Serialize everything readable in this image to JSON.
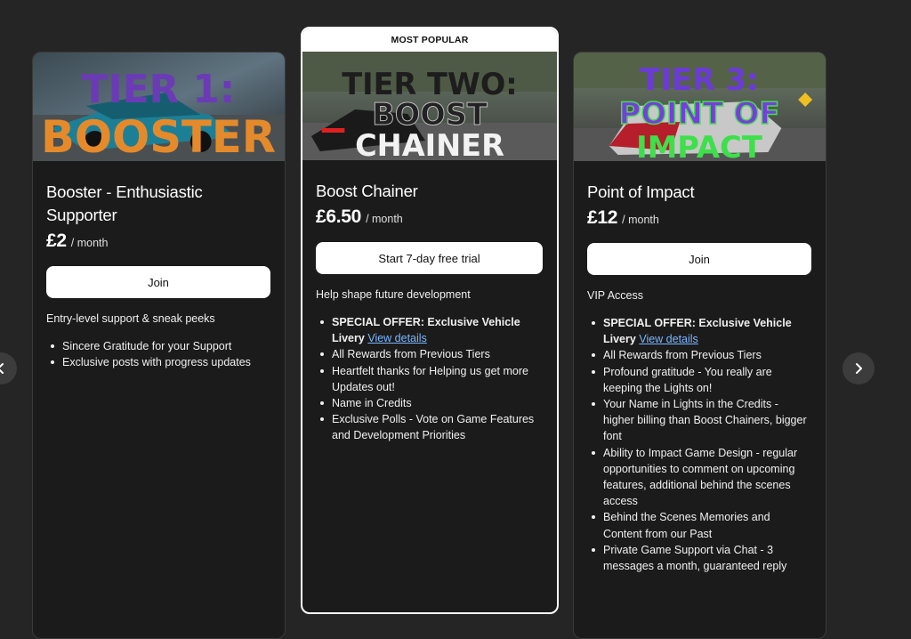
{
  "tiers": [
    {
      "banner_lines": [
        "TIER 1:",
        "BOOSTER"
      ],
      "name_line1": "Booster - Enthusiastic",
      "name_line2": "Supporter",
      "price": "£2",
      "period": "/ month",
      "cta": "Join",
      "description": "Entry-level support & sneak peeks",
      "benefits": [
        "Sincere Gratitude for your Support",
        "Exclusive posts with progress updates"
      ]
    },
    {
      "badge": "MOST POPULAR",
      "banner_lines": [
        "TIER TWO:",
        "BOOST",
        "CHAINER"
      ],
      "name_line1": "Boost Chainer",
      "price": "£6.50",
      "period": "/ month",
      "cta": "Start 7-day free trial",
      "description": "Help shape future development",
      "special_offer": "SPECIAL OFFER: Exclusive Vehicle",
      "special_offer_tail": "Livery",
      "special_offer_link": "View details",
      "benefits": [
        "All Rewards from Previous Tiers",
        "Heartfelt thanks for Helping us get more Updates out!",
        "Name in Credits",
        "Exclusive Polls - Vote on Game Features and Development Priorities"
      ]
    },
    {
      "banner_lines": [
        "TIER 3:",
        "POINT OF",
        "IMPACT"
      ],
      "name_line1": "Point of Impact",
      "price": "£12",
      "period": "/ month",
      "cta": "Join",
      "description": "VIP Access",
      "special_offer": "SPECIAL OFFER: Exclusive Vehicle",
      "special_offer_tail": "Livery",
      "special_offer_link": "View details",
      "benefits": [
        "All Rewards from Previous Tiers",
        "Profound gratitude - You really are keeping the Lights on!",
        "Your Name in Lights in the Credits - higher billing than Boost Chainers, bigger font",
        "Ability to Impact Game Design - regular opportunities to comment on upcoming features, additional behind the scenes access",
        "Behind the Scenes Memories and Content from our Past",
        "Private Game Support via Chat - 3 messages a month, guaranteed reply"
      ]
    }
  ],
  "nav": {
    "prev_icon": "chevron-left-icon",
    "next_icon": "chevron-right-icon"
  },
  "colors": {
    "background": "#252525",
    "card": "#1b1b1c",
    "link": "#7ab7ff"
  }
}
